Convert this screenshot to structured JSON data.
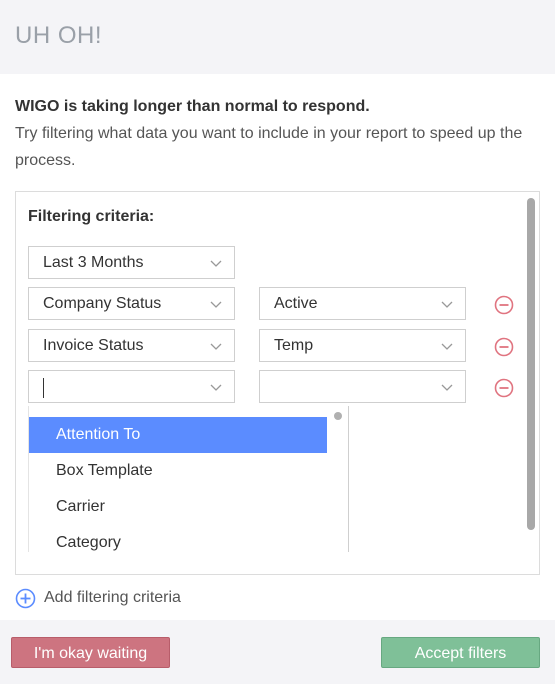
{
  "dialog": {
    "title": "UH OH!",
    "message_bold": "WIGO is taking longer than normal to respond.",
    "message_rest": "Try filtering what data you want to include in your report to speed up the process."
  },
  "filters": {
    "title": "Filtering criteria:",
    "date_range": "Last 3 Months",
    "rows": [
      {
        "field": "Company Status",
        "value": "Active"
      },
      {
        "field": "Invoice Status",
        "value": "Temp"
      },
      {
        "field": "",
        "value": ""
      }
    ],
    "dropdown_options": [
      "Attention To",
      "Box Template",
      "Carrier",
      "Category"
    ],
    "highlighted_option": "Attention To"
  },
  "add_label": "Add filtering criteria",
  "buttons": {
    "wait_label": "I'm okay waiting",
    "accept_label": "Accept filters"
  },
  "colors": {
    "remove_icon": "#e07480",
    "add_icon": "#5b8cff",
    "highlight": "#5b8cff",
    "wait_button": "#cd7480",
    "accept_button": "#7fc098"
  },
  "icons": [
    "chevron-down-icon",
    "minus-circle-icon",
    "plus-circle-icon"
  ]
}
